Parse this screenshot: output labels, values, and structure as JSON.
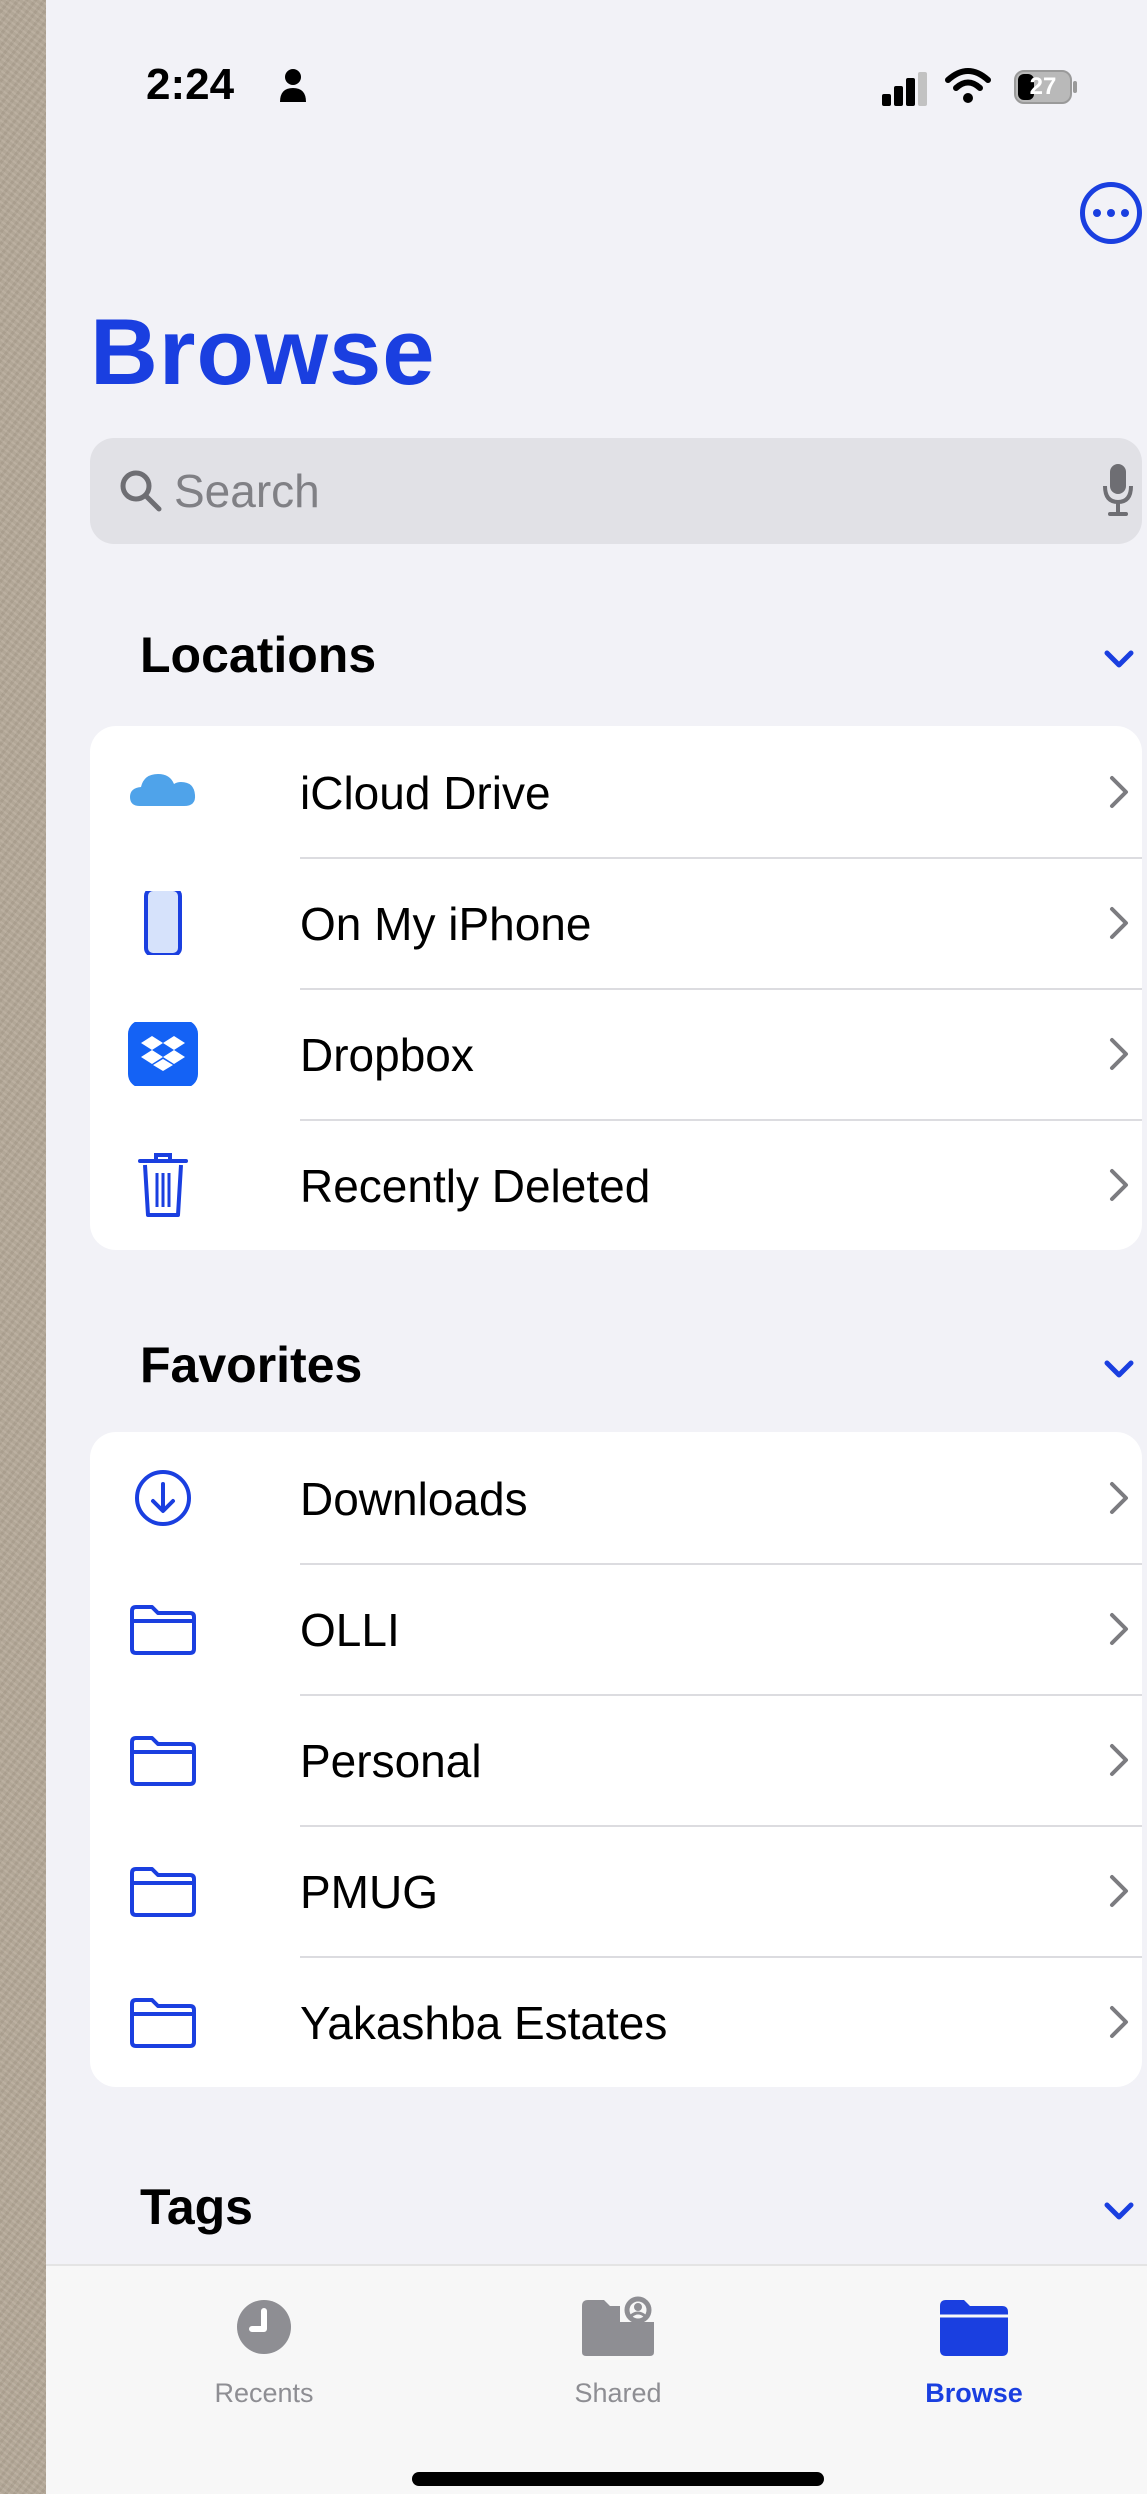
{
  "status_bar": {
    "time": "2:24",
    "battery_level": "27",
    "icons": [
      "person-icon",
      "signal-icon",
      "wifi-icon",
      "battery-icon"
    ]
  },
  "header": {
    "more_icon": "ellipsis-circle-icon",
    "title": "Browse"
  },
  "search": {
    "placeholder": "Search",
    "value": "",
    "icon": "magnifier-icon",
    "mic_icon": "microphone-icon"
  },
  "locations": {
    "title": "Locations",
    "items": [
      {
        "label": "iCloud Drive",
        "icon": "icloud-icon"
      },
      {
        "label": "On My iPhone",
        "icon": "iphone-icon"
      },
      {
        "label": "Dropbox",
        "icon": "dropbox-icon"
      },
      {
        "label": "Recently Deleted",
        "icon": "trash-icon"
      }
    ]
  },
  "favorites": {
    "title": "Favorites",
    "items": [
      {
        "label": "Downloads",
        "icon": "download-icon"
      },
      {
        "label": "OLLI",
        "icon": "folder-icon"
      },
      {
        "label": "Personal",
        "icon": "folder-icon"
      },
      {
        "label": "PMUG",
        "icon": "folder-icon"
      },
      {
        "label": "Yakashba Estates",
        "icon": "folder-icon"
      }
    ]
  },
  "tags": {
    "title": "Tags"
  },
  "tab_bar": {
    "tabs": [
      {
        "label": "Recents",
        "icon": "clock-icon",
        "active": false
      },
      {
        "label": "Shared",
        "icon": "shared-folder-icon",
        "active": false
      },
      {
        "label": "Browse",
        "icon": "folder-fill-icon",
        "active": true
      }
    ]
  },
  "colors": {
    "accent": "#1a3fe0",
    "background": "#f2f2f7",
    "icloud": "#4fa3ea",
    "dropbox": "#1462f5",
    "inactive": "#8e8e93"
  }
}
